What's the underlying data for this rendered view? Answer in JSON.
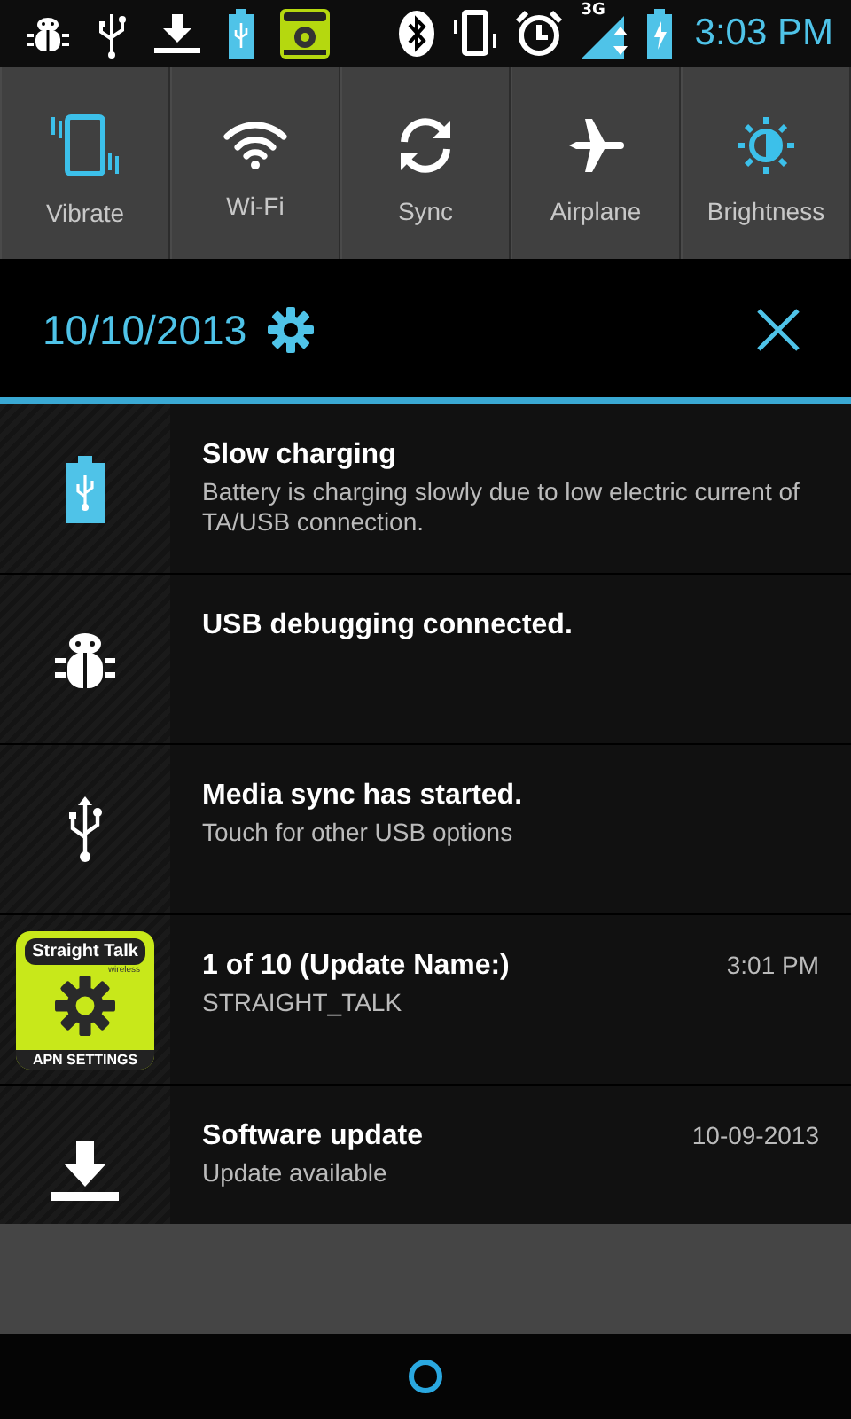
{
  "status_bar": {
    "network_type": "3G",
    "time": "3:03 PM"
  },
  "quick_settings": [
    {
      "label": "Vibrate",
      "kind": "vibrate",
      "on": true
    },
    {
      "label": "Wi-Fi",
      "kind": "wifi",
      "on": false
    },
    {
      "label": "Sync",
      "kind": "sync",
      "on": false
    },
    {
      "label": "Airplane",
      "kind": "airplane",
      "on": false
    },
    {
      "label": "Brightness",
      "kind": "brightness",
      "on": true
    }
  ],
  "header": {
    "date": "10/10/2013"
  },
  "notifications": [
    {
      "kind": "battery",
      "title": "Slow charging",
      "text": "Battery is charging slowly due to low electric current of TA/USB connection."
    },
    {
      "kind": "bug",
      "title": "USB debugging connected."
    },
    {
      "kind": "usb",
      "title": "Media sync has started.",
      "text": "Touch for other USB options"
    },
    {
      "kind": "app",
      "app_icon": {
        "brand": "Straight Talk",
        "tagline": "wireless",
        "caption": "APN SETTINGS"
      },
      "title": "1 of 10 (Update Name:)",
      "text": "STRAIGHT_TALK",
      "time": "3:01 PM"
    },
    {
      "kind": "download",
      "title": "Software update",
      "text": "Update available",
      "time": "10-09-2013"
    }
  ]
}
